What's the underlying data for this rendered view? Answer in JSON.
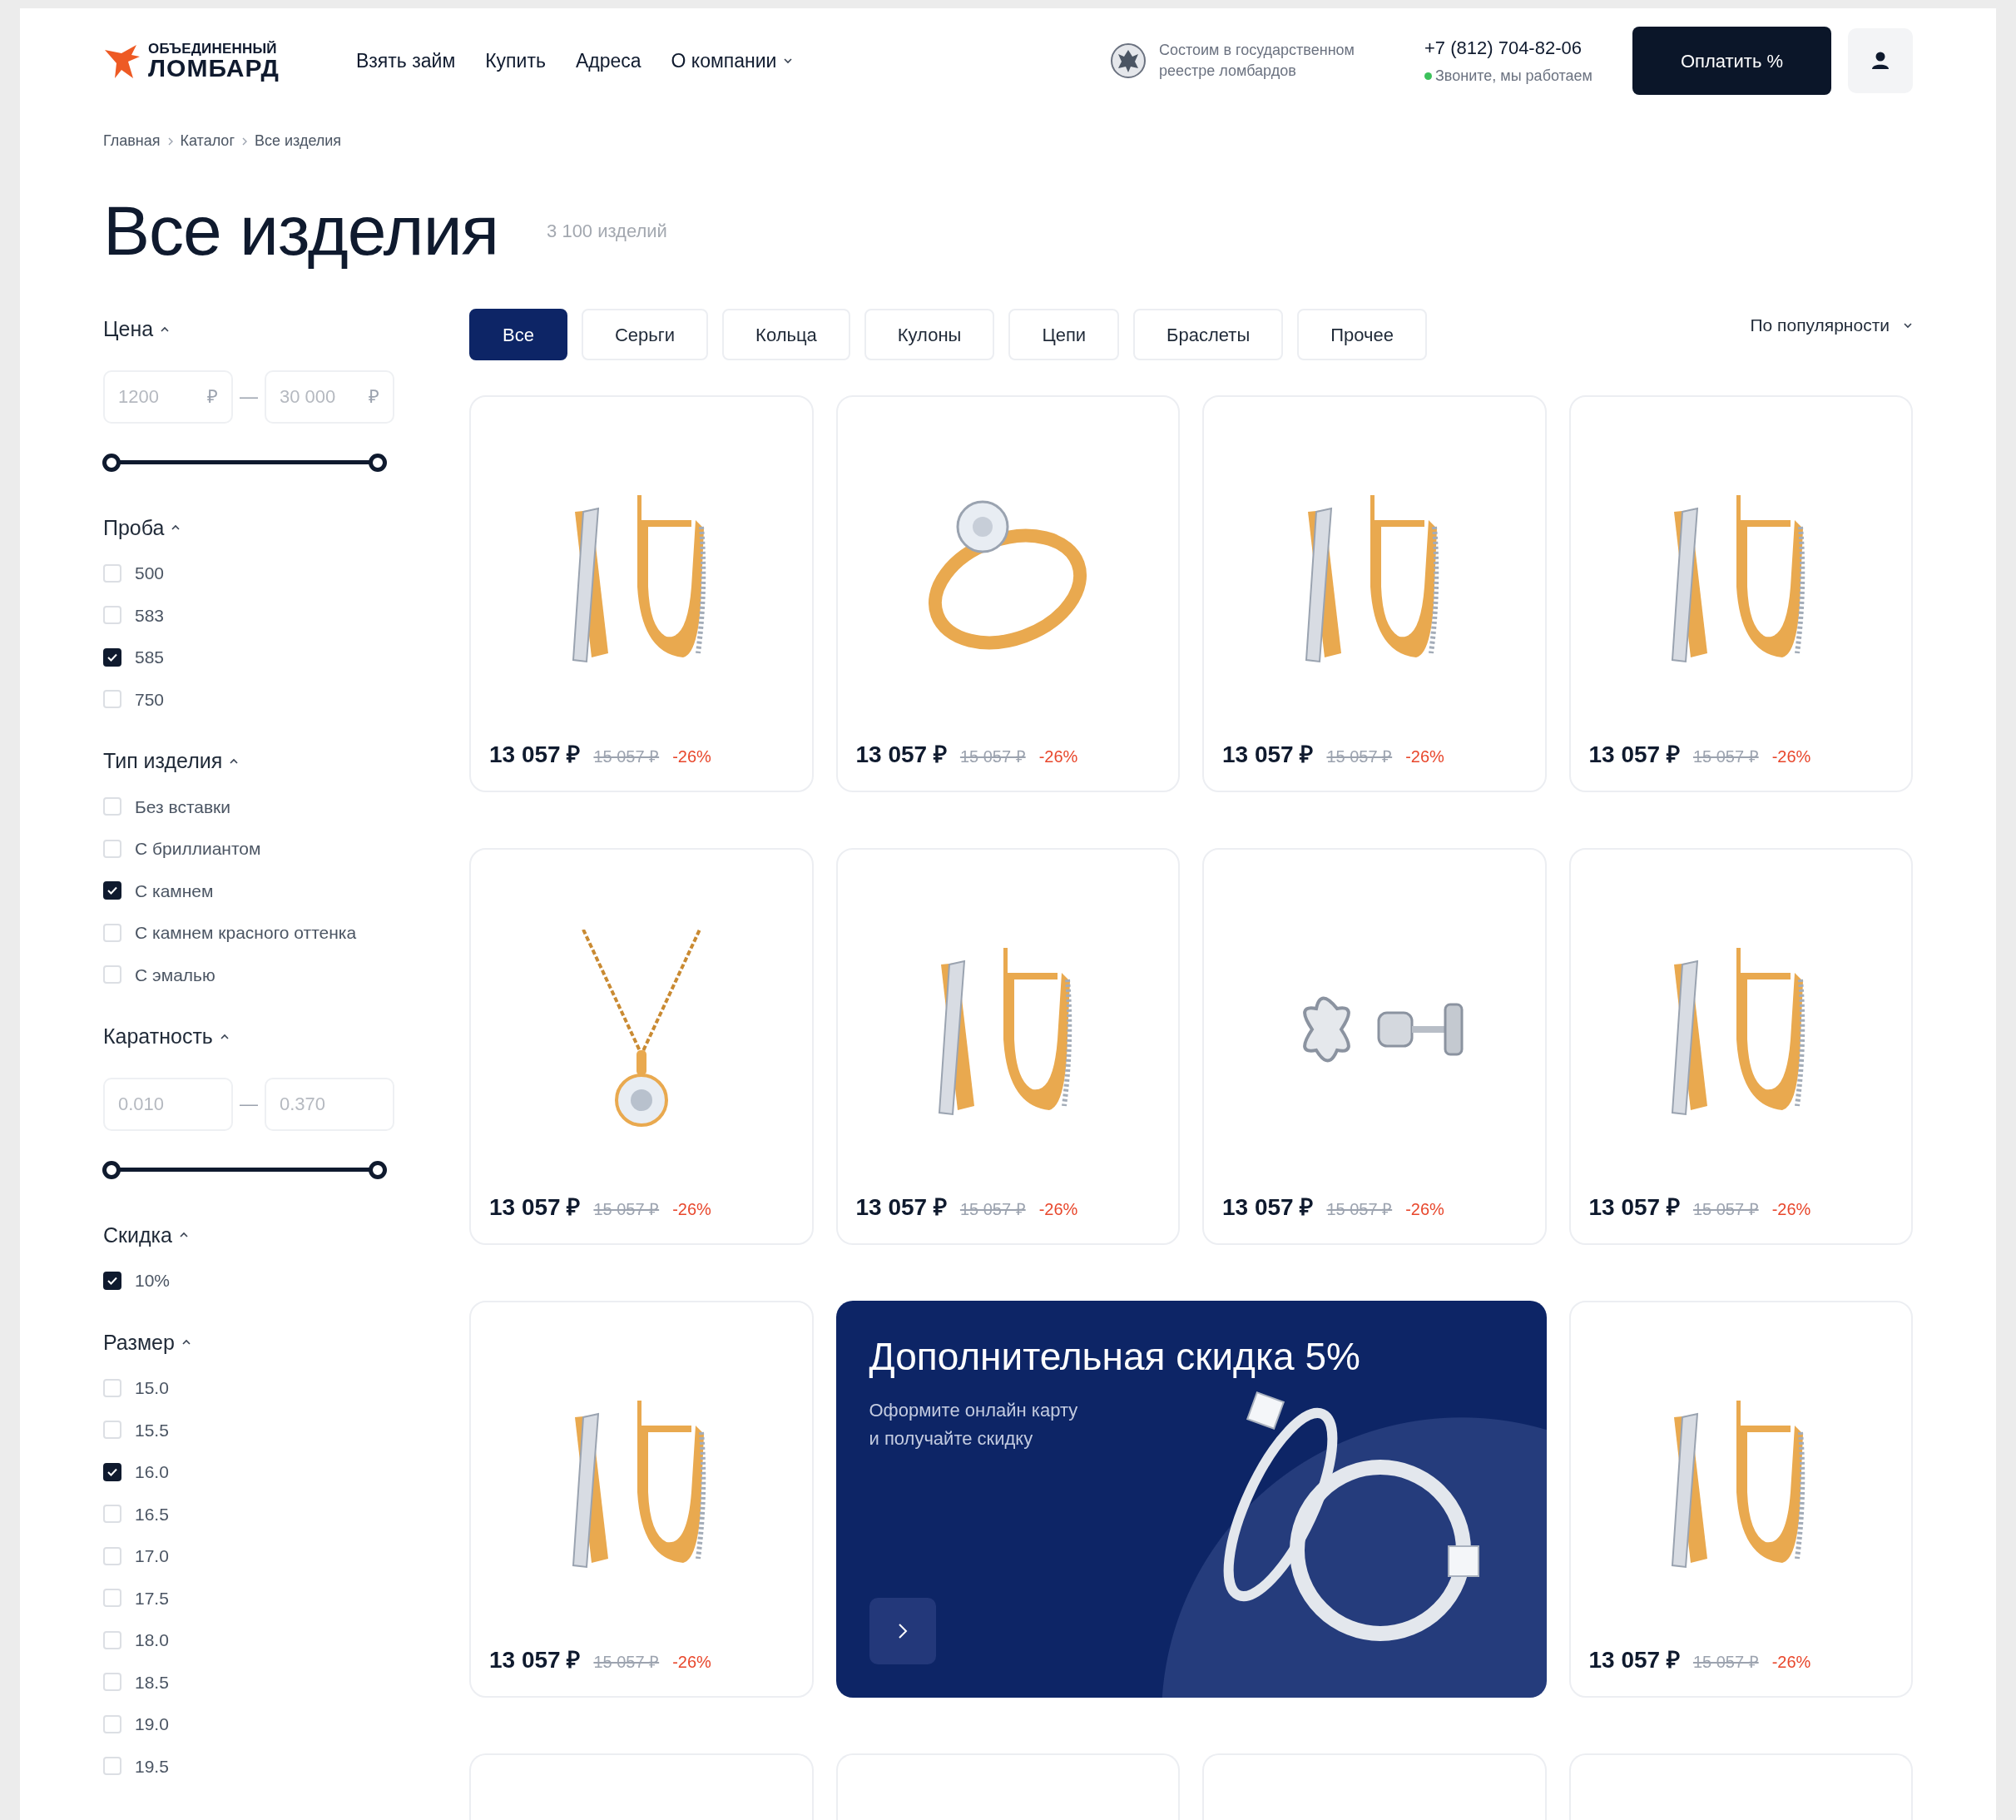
{
  "header": {
    "logo": {
      "line1": "ОБЪЕДИНЕННЫЙ",
      "line2": "ЛОМБАРД"
    },
    "nav": [
      {
        "label": "Взять займ",
        "dropdown": false
      },
      {
        "label": "Купить",
        "dropdown": false
      },
      {
        "label": "Адреса",
        "dropdown": false
      },
      {
        "label": "О компании",
        "dropdown": true
      }
    ],
    "registry_note": "Состоим в государственном\nреестре ломбардов",
    "phone": "+7 (812) 704-82-06",
    "status": "Звоните, мы работаем",
    "pay_button": "Оплатить %"
  },
  "breadcrumbs": [
    "Главная",
    "Каталог",
    "Все изделия"
  ],
  "title": "Все изделия",
  "count": "3 100 изделий",
  "filters": [
    {
      "kind": "range",
      "title": "Цена",
      "expanded": true,
      "fields": [
        {
          "placeholder": "1200",
          "suffix": "₽"
        },
        {
          "placeholder": "30 000",
          "suffix": "₽"
        }
      ],
      "separator": "—",
      "slider": [
        {
          "level": 0
        },
        {
          "level": 1
        }
      ]
    },
    {
      "kind": "checklist",
      "title": "Проба",
      "expanded": true,
      "options": [
        {
          "label": "500",
          "checked": false
        },
        {
          "label": "583",
          "checked": false
        },
        {
          "label": "585",
          "checked": true
        },
        {
          "label": "750",
          "checked": false
        }
      ]
    },
    {
      "kind": "checklist",
      "title": "Тип изделия",
      "expanded": true,
      "options": [
        {
          "label": "Без вставки",
          "checked": false
        },
        {
          "label": "С бриллиантом",
          "checked": false
        },
        {
          "label": "С камнем",
          "checked": true
        },
        {
          "label": "С камнем красного оттенка",
          "checked": false
        },
        {
          "label": "С эмалью",
          "checked": false
        }
      ]
    },
    {
      "kind": "range",
      "title": "Каратность",
      "expanded": true,
      "fields": [
        {
          "placeholder": "0.010"
        },
        {
          "placeholder": "0.370"
        }
      ],
      "separator": "—",
      "slider": [
        {
          "level": 0
        },
        {
          "level": 1
        }
      ]
    },
    {
      "kind": "checklist",
      "title": "Скидка",
      "expanded": true,
      "options": [
        {
          "label": "10%",
          "checked": true
        }
      ]
    },
    {
      "kind": "checklist",
      "title": "Размер",
      "expanded": true,
      "options": [
        {
          "label": "15.0",
          "checked": false
        },
        {
          "label": "15.5",
          "checked": false
        },
        {
          "label": "16.0",
          "checked": true
        },
        {
          "label": "16.5",
          "checked": false
        },
        {
          "label": "17.0",
          "checked": false
        },
        {
          "label": "17.5",
          "checked": false
        },
        {
          "label": "18.0",
          "checked": false
        },
        {
          "label": "18.5",
          "checked": false
        },
        {
          "label": "19.0",
          "checked": false
        },
        {
          "label": "19.5",
          "checked": false
        }
      ]
    }
  ],
  "category_tabs": [
    {
      "label": "Все",
      "selected": true
    },
    {
      "label": "Серьги",
      "selected": false
    },
    {
      "label": "Кольца",
      "selected": false
    },
    {
      "label": "Кулоны",
      "selected": false
    },
    {
      "label": "Цепи",
      "selected": false
    },
    {
      "label": "Браслеты",
      "selected": false
    },
    {
      "label": "Прочее",
      "selected": false
    }
  ],
  "sort": "По популярности",
  "items": [
    {
      "kind": "earrings",
      "price": "13 057 ₽",
      "old_price": "15 057 ₽",
      "discount": "-26%"
    },
    {
      "kind": "ring",
      "price": "13 057 ₽",
      "old_price": "15 057 ₽",
      "discount": "-26%"
    },
    {
      "kind": "earrings",
      "price": "13 057 ₽",
      "old_price": "15 057 ₽",
      "discount": "-26%"
    },
    {
      "kind": "earrings",
      "price": "13 057 ₽",
      "old_price": "15 057 ₽",
      "discount": "-26%"
    },
    {
      "kind": "pendant",
      "price": "13 057 ₽",
      "old_price": "15 057 ₽",
      "discount": "-26%"
    },
    {
      "kind": "earrings",
      "price": "13 057 ₽",
      "old_price": "15 057 ₽",
      "discount": "-26%"
    },
    {
      "kind": "studs",
      "price": "13 057 ₽",
      "old_price": "15 057 ₽",
      "discount": "-26%"
    },
    {
      "kind": "earrings",
      "price": "13 057 ₽",
      "old_price": "15 057 ₽",
      "discount": "-26%"
    },
    {
      "kind": "earrings",
      "price": "13 057 ₽",
      "old_price": "15 057 ₽",
      "discount": "-26%"
    },
    {
      "kind": "promo",
      "title": "Дополнительная скидка 5%",
      "text": "Оформите онлайн карту\nи получайте скидку"
    },
    {
      "kind": "earrings",
      "price": "13 057 ₽",
      "old_price": "15 057 ₽",
      "discount": "-26%"
    },
    {
      "kind": "cut_off"
    },
    {
      "kind": "cut_off"
    },
    {
      "kind": "cut_off"
    },
    {
      "kind": "cut_off"
    }
  ]
}
